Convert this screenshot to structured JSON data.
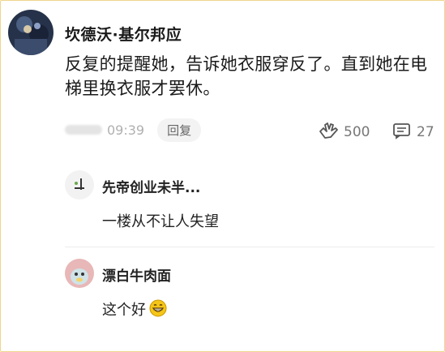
{
  "comment": {
    "author": "坎德沃·基尔邦应",
    "text": "反复的提醒她，告诉她衣服穿反了。直到她在电梯里换衣服才罢休。",
    "time": "09:39",
    "reply_label": "回复",
    "likes": "500",
    "replies_count": "27"
  },
  "sub_replies": [
    {
      "name": "先帝创业未半...",
      "text": "一楼从不让人失望"
    },
    {
      "name": "漂白牛肉面",
      "text": "这个好"
    }
  ],
  "colors": {
    "frame": "#f0d58a",
    "muted": "#b0b0b0",
    "emoji": "#f5c518"
  },
  "icons": [
    "like-icon",
    "comment-icon",
    "grin-emoji-icon"
  ]
}
